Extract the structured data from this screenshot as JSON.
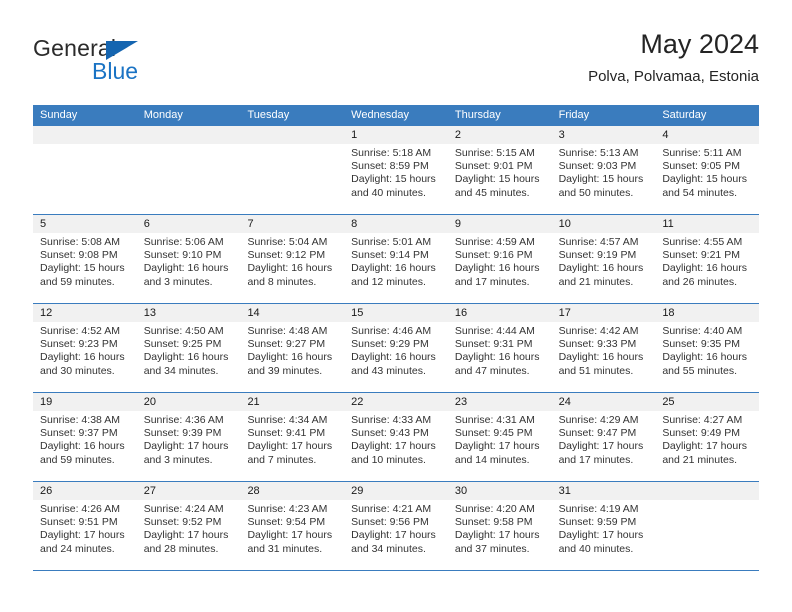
{
  "brand": {
    "line1": "General",
    "line2": "Blue",
    "triangle_color": "#1565b0",
    "blue_text_color": "#1a73c4"
  },
  "header": {
    "title": "May 2024",
    "location": "Polva, Polvamaa, Estonia"
  },
  "theme": {
    "header_blue": "#3a7cbe",
    "daynum_gray": "#f1f1f1",
    "text": "#333333"
  },
  "weekdays": [
    "Sunday",
    "Monday",
    "Tuesday",
    "Wednesday",
    "Thursday",
    "Friday",
    "Saturday"
  ],
  "labels": {
    "sunrise_prefix": "Sunrise: ",
    "sunset_prefix": "Sunset: ",
    "daylight_prefix": "Daylight: "
  },
  "weeks": [
    [
      {
        "day": ""
      },
      {
        "day": ""
      },
      {
        "day": ""
      },
      {
        "day": "1",
        "sunrise": "Sunrise: 5:18 AM",
        "sunset": "Sunset: 8:59 PM",
        "daylight": "Daylight: 15 hours and 40 minutes."
      },
      {
        "day": "2",
        "sunrise": "Sunrise: 5:15 AM",
        "sunset": "Sunset: 9:01 PM",
        "daylight": "Daylight: 15 hours and 45 minutes."
      },
      {
        "day": "3",
        "sunrise": "Sunrise: 5:13 AM",
        "sunset": "Sunset: 9:03 PM",
        "daylight": "Daylight: 15 hours and 50 minutes."
      },
      {
        "day": "4",
        "sunrise": "Sunrise: 5:11 AM",
        "sunset": "Sunset: 9:05 PM",
        "daylight": "Daylight: 15 hours and 54 minutes."
      }
    ],
    [
      {
        "day": "5",
        "sunrise": "Sunrise: 5:08 AM",
        "sunset": "Sunset: 9:08 PM",
        "daylight": "Daylight: 15 hours and 59 minutes."
      },
      {
        "day": "6",
        "sunrise": "Sunrise: 5:06 AM",
        "sunset": "Sunset: 9:10 PM",
        "daylight": "Daylight: 16 hours and 3 minutes."
      },
      {
        "day": "7",
        "sunrise": "Sunrise: 5:04 AM",
        "sunset": "Sunset: 9:12 PM",
        "daylight": "Daylight: 16 hours and 8 minutes."
      },
      {
        "day": "8",
        "sunrise": "Sunrise: 5:01 AM",
        "sunset": "Sunset: 9:14 PM",
        "daylight": "Daylight: 16 hours and 12 minutes."
      },
      {
        "day": "9",
        "sunrise": "Sunrise: 4:59 AM",
        "sunset": "Sunset: 9:16 PM",
        "daylight": "Daylight: 16 hours and 17 minutes."
      },
      {
        "day": "10",
        "sunrise": "Sunrise: 4:57 AM",
        "sunset": "Sunset: 9:19 PM",
        "daylight": "Daylight: 16 hours and 21 minutes."
      },
      {
        "day": "11",
        "sunrise": "Sunrise: 4:55 AM",
        "sunset": "Sunset: 9:21 PM",
        "daylight": "Daylight: 16 hours and 26 minutes."
      }
    ],
    [
      {
        "day": "12",
        "sunrise": "Sunrise: 4:52 AM",
        "sunset": "Sunset: 9:23 PM",
        "daylight": "Daylight: 16 hours and 30 minutes."
      },
      {
        "day": "13",
        "sunrise": "Sunrise: 4:50 AM",
        "sunset": "Sunset: 9:25 PM",
        "daylight": "Daylight: 16 hours and 34 minutes."
      },
      {
        "day": "14",
        "sunrise": "Sunrise: 4:48 AM",
        "sunset": "Sunset: 9:27 PM",
        "daylight": "Daylight: 16 hours and 39 minutes."
      },
      {
        "day": "15",
        "sunrise": "Sunrise: 4:46 AM",
        "sunset": "Sunset: 9:29 PM",
        "daylight": "Daylight: 16 hours and 43 minutes."
      },
      {
        "day": "16",
        "sunrise": "Sunrise: 4:44 AM",
        "sunset": "Sunset: 9:31 PM",
        "daylight": "Daylight: 16 hours and 47 minutes."
      },
      {
        "day": "17",
        "sunrise": "Sunrise: 4:42 AM",
        "sunset": "Sunset: 9:33 PM",
        "daylight": "Daylight: 16 hours and 51 minutes."
      },
      {
        "day": "18",
        "sunrise": "Sunrise: 4:40 AM",
        "sunset": "Sunset: 9:35 PM",
        "daylight": "Daylight: 16 hours and 55 minutes."
      }
    ],
    [
      {
        "day": "19",
        "sunrise": "Sunrise: 4:38 AM",
        "sunset": "Sunset: 9:37 PM",
        "daylight": "Daylight: 16 hours and 59 minutes."
      },
      {
        "day": "20",
        "sunrise": "Sunrise: 4:36 AM",
        "sunset": "Sunset: 9:39 PM",
        "daylight": "Daylight: 17 hours and 3 minutes."
      },
      {
        "day": "21",
        "sunrise": "Sunrise: 4:34 AM",
        "sunset": "Sunset: 9:41 PM",
        "daylight": "Daylight: 17 hours and 7 minutes."
      },
      {
        "day": "22",
        "sunrise": "Sunrise: 4:33 AM",
        "sunset": "Sunset: 9:43 PM",
        "daylight": "Daylight: 17 hours and 10 minutes."
      },
      {
        "day": "23",
        "sunrise": "Sunrise: 4:31 AM",
        "sunset": "Sunset: 9:45 PM",
        "daylight": "Daylight: 17 hours and 14 minutes."
      },
      {
        "day": "24",
        "sunrise": "Sunrise: 4:29 AM",
        "sunset": "Sunset: 9:47 PM",
        "daylight": "Daylight: 17 hours and 17 minutes."
      },
      {
        "day": "25",
        "sunrise": "Sunrise: 4:27 AM",
        "sunset": "Sunset: 9:49 PM",
        "daylight": "Daylight: 17 hours and 21 minutes."
      }
    ],
    [
      {
        "day": "26",
        "sunrise": "Sunrise: 4:26 AM",
        "sunset": "Sunset: 9:51 PM",
        "daylight": "Daylight: 17 hours and 24 minutes."
      },
      {
        "day": "27",
        "sunrise": "Sunrise: 4:24 AM",
        "sunset": "Sunset: 9:52 PM",
        "daylight": "Daylight: 17 hours and 28 minutes."
      },
      {
        "day": "28",
        "sunrise": "Sunrise: 4:23 AM",
        "sunset": "Sunset: 9:54 PM",
        "daylight": "Daylight: 17 hours and 31 minutes."
      },
      {
        "day": "29",
        "sunrise": "Sunrise: 4:21 AM",
        "sunset": "Sunset: 9:56 PM",
        "daylight": "Daylight: 17 hours and 34 minutes."
      },
      {
        "day": "30",
        "sunrise": "Sunrise: 4:20 AM",
        "sunset": "Sunset: 9:58 PM",
        "daylight": "Daylight: 17 hours and 37 minutes."
      },
      {
        "day": "31",
        "sunrise": "Sunrise: 4:19 AM",
        "sunset": "Sunset: 9:59 PM",
        "daylight": "Daylight: 17 hours and 40 minutes."
      },
      {
        "day": ""
      }
    ]
  ]
}
